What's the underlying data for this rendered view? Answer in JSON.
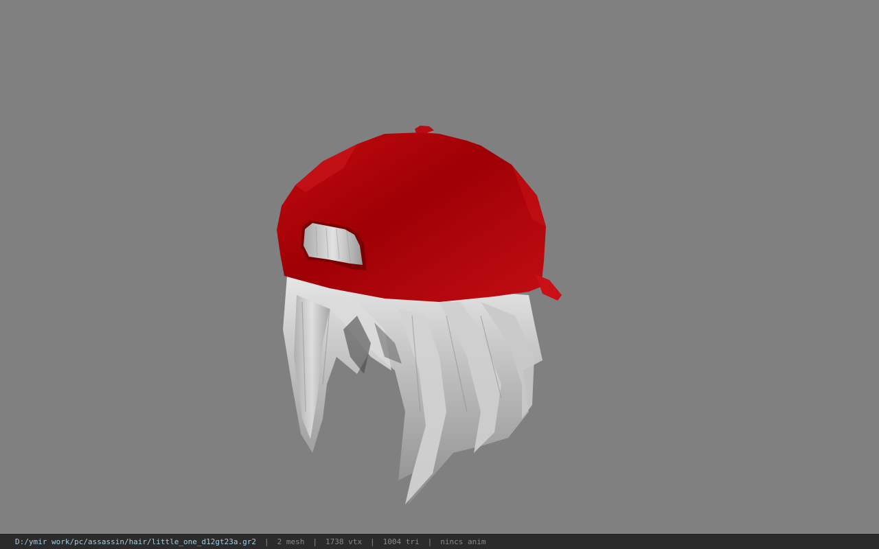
{
  "viewport": {
    "background_color": "#808080",
    "model": {
      "name": "baseball-cap-with-silver-hair",
      "cap_color": "#b00008",
      "hair_color": "#c4c4c4"
    }
  },
  "status_bar": {
    "file_path": "D:/ymir work/pc/assassin/hair/little_one_d12gt23a.gr2",
    "separator": "|",
    "mesh": "2 mesh",
    "vertices": "1738 vtx",
    "triangles": "1004 tri",
    "animation": "nincs anim",
    "path_color": "#9fd0e6",
    "text_color": "#8a8a8a"
  }
}
